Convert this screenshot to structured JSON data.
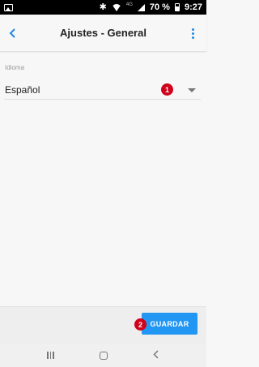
{
  "status_bar": {
    "battery_text": "70 %",
    "time": "9:27",
    "network_label": "4G"
  },
  "app_bar": {
    "title": "Ajustes - General"
  },
  "settings": {
    "language_label": "Idioma",
    "language_value": "Español"
  },
  "badges": {
    "one": "1",
    "two": "2"
  },
  "footer": {
    "save_label": "GUARDAR"
  },
  "colors": {
    "accent": "#1e88e5",
    "button": "#2196f3",
    "badge": "#d0021b"
  }
}
